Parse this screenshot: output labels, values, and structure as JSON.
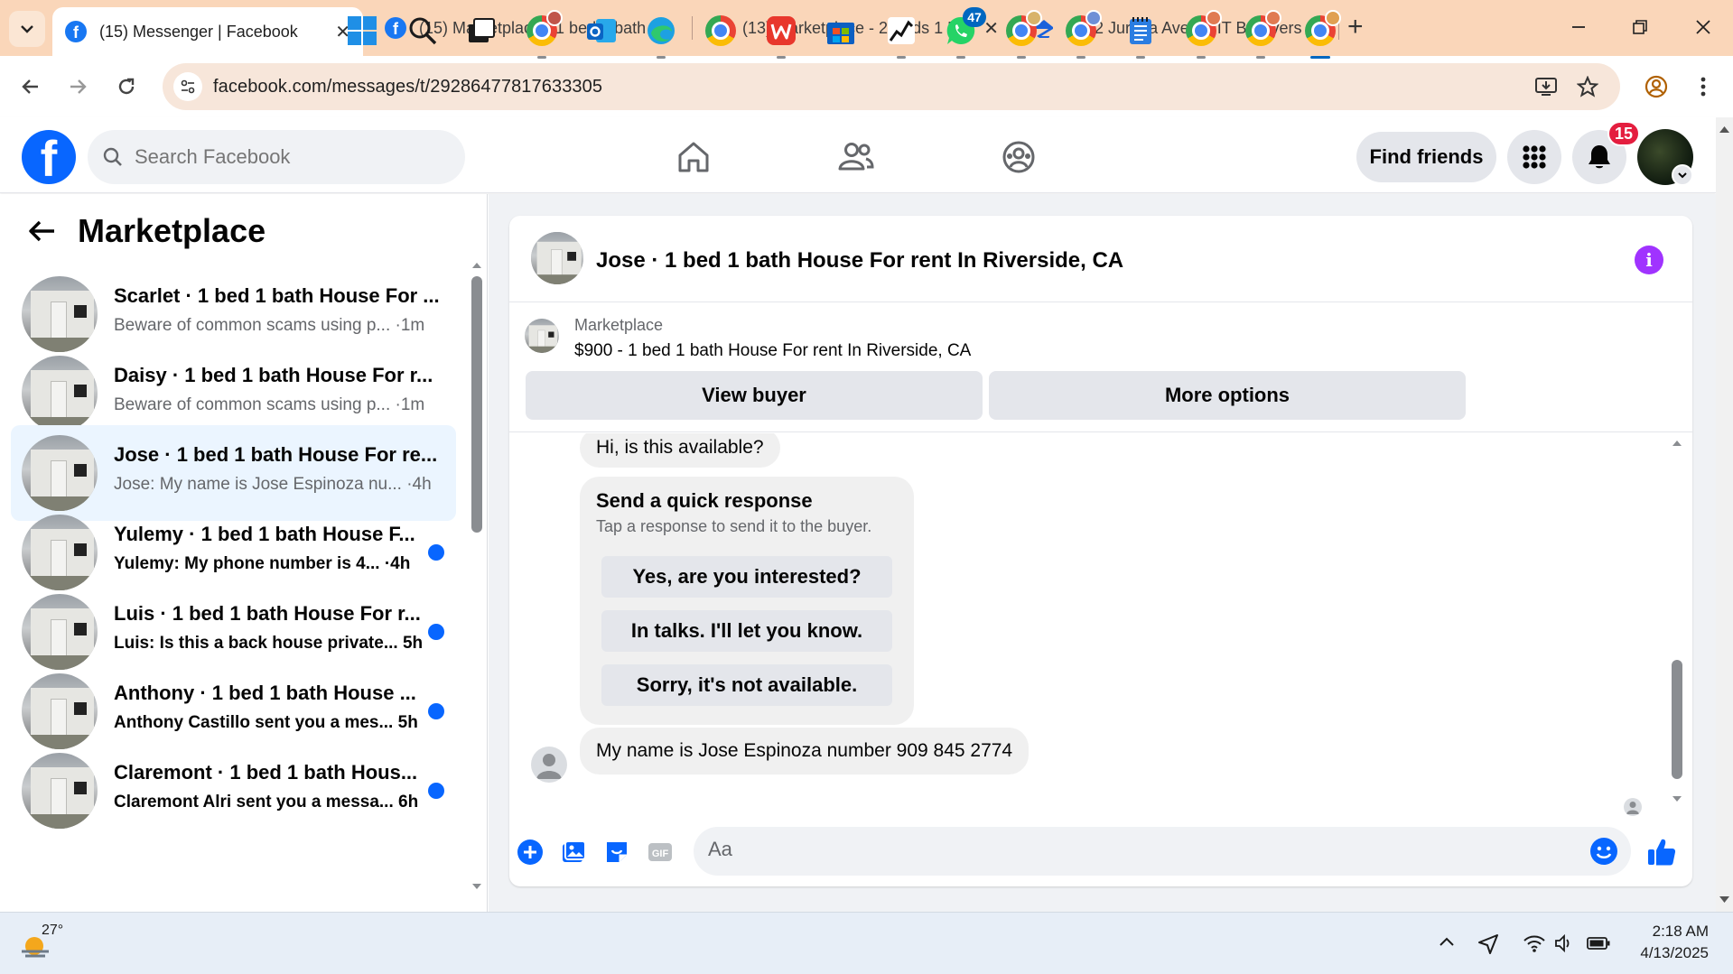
{
  "browser": {
    "tabs": [
      {
        "title": "(15) Messenger | Facebook",
        "icon": "facebook-icon",
        "active": true
      },
      {
        "title": "(15) Marketplace - 1 bed 1 bath",
        "icon": "facebook-icon",
        "active": false
      },
      {
        "title": "(13) Marketplace - 2 Beds 1 Bat",
        "icon": "facebook-icon",
        "active": false
      },
      {
        "title": "5092 Jurupa Ave UNIT B, Riversi",
        "icon": "zillow-icon",
        "active": false
      }
    ],
    "url": "facebook.com/messages/t/29286477817633305",
    "colors": {
      "tabbar": "#fad6b9",
      "omnibox": "#f7e6da"
    }
  },
  "fb": {
    "search_placeholder": "Search Facebook",
    "find_friends": "Find friends",
    "notifications_count": "15",
    "brand_color": "#0866ff"
  },
  "sidebar": {
    "title": "Marketplace",
    "conversations": [
      {
        "name": "Scarlet · 1 bed 1 bath House For ...",
        "preview": "Beware of common scams using p...",
        "time": "·1m",
        "unread": false,
        "active": false
      },
      {
        "name": "Daisy · 1 bed 1 bath House For r...",
        "preview": "Beware of common scams using p...",
        "time": "·1m",
        "unread": false,
        "active": false
      },
      {
        "name": "Jose · 1 bed 1 bath House For re...",
        "preview": "Jose: My name is Jose Espinoza nu...",
        "time": "·4h",
        "unread": false,
        "active": true
      },
      {
        "name": "Yulemy · 1 bed 1 bath House F...",
        "preview": "Yulemy: My phone number is 4...",
        "time": "·4h",
        "unread": true,
        "active": false
      },
      {
        "name": "Luis · 1 bed 1 bath House For r...",
        "preview": "Luis: Is this a back house private...",
        "time": "5h",
        "unread": true,
        "active": false
      },
      {
        "name": "Anthony · 1 bed 1 bath House ...",
        "preview": "Anthony Castillo sent you a mes...",
        "time": "5h",
        "unread": true,
        "active": false
      },
      {
        "name": "Claremont · 1 bed 1 bath Hous...",
        "preview": "Claremont Alri sent you a messa...",
        "time": "6h",
        "unread": true,
        "active": false
      }
    ]
  },
  "chat": {
    "title": "Jose · 1 bed 1 bath House For rent In Riverside, CA",
    "listing_label": "Marketplace",
    "listing_desc": "$900 - 1 bed 1 bath House For rent In Riverside, CA",
    "view_buyer": "View buyer",
    "more_options": "More options",
    "messages": {
      "first": "Hi, is this available?",
      "quick_title": "Send a quick response",
      "quick_sub": "Tap a response to send it to the buyer.",
      "quick_options": [
        "Yes, are you interested?",
        "In talks. I'll let you know.",
        "Sorry, it's not available."
      ],
      "received": "My name is Jose Espinoza number  909 845 2774"
    },
    "composer_placeholder": "Aa"
  },
  "taskbar": {
    "weather_temp": "27°",
    "whatsapp_badge": "47",
    "time": "2:18 AM",
    "date": "4/13/2025"
  }
}
